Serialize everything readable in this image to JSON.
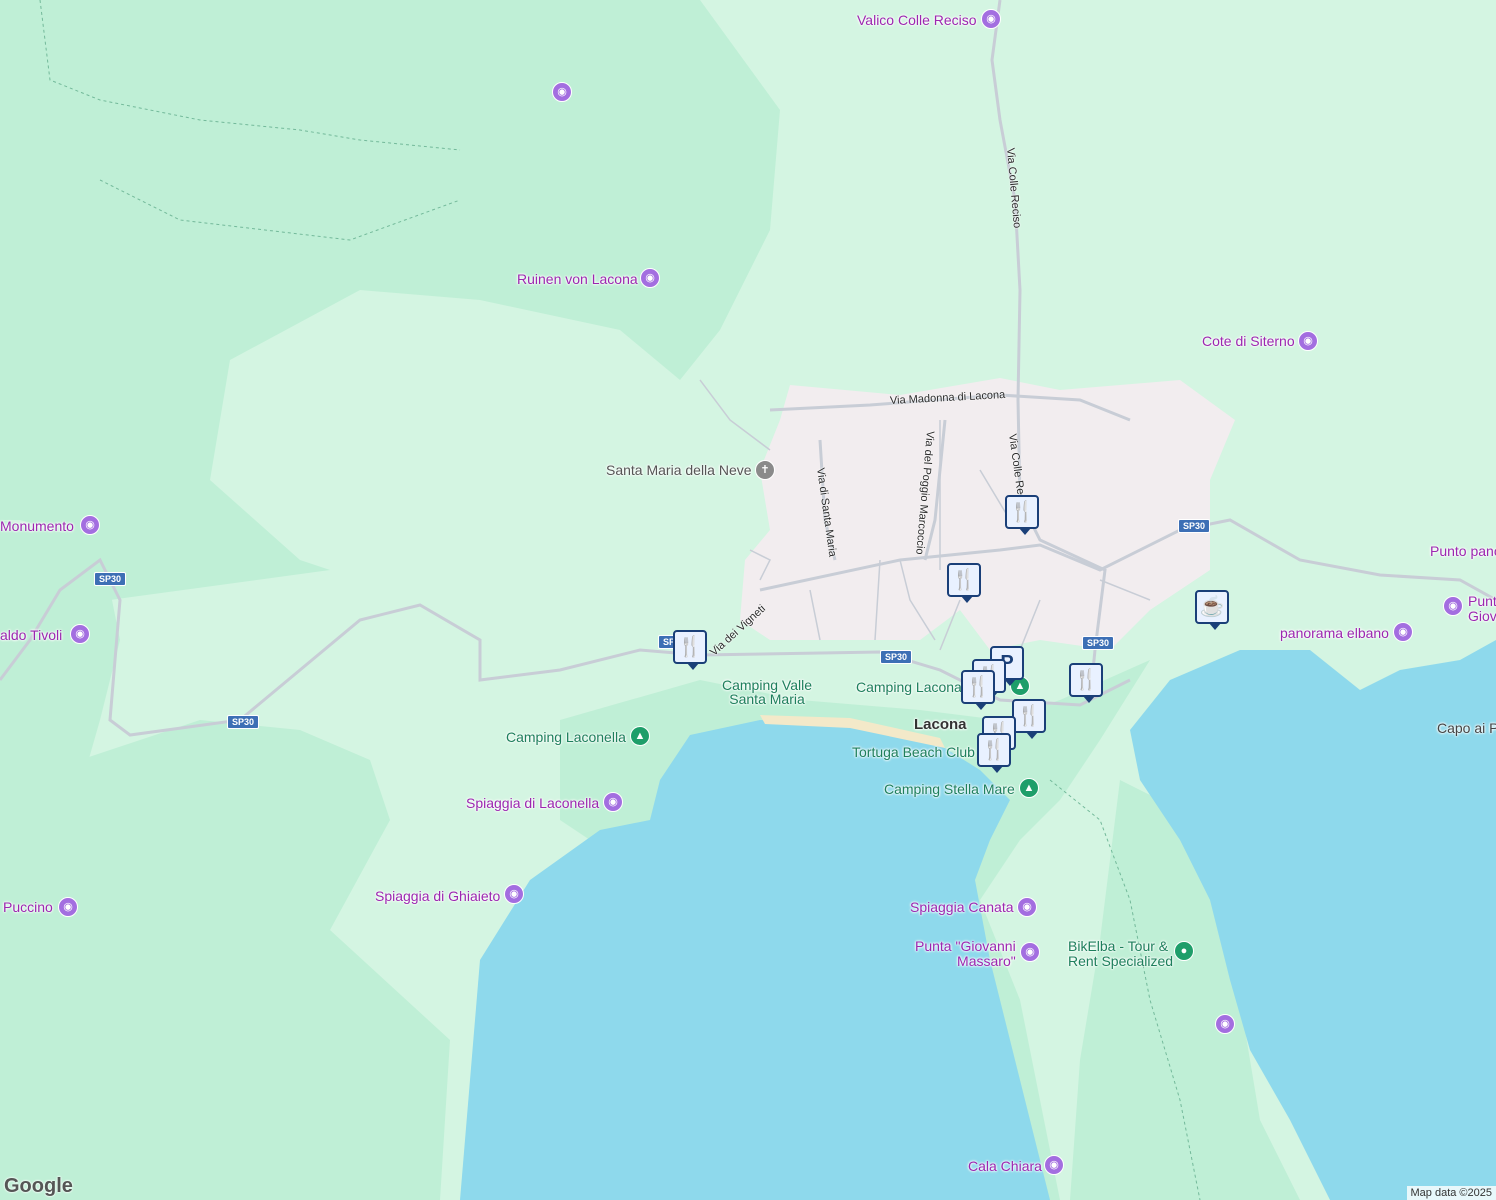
{
  "map": {
    "colors": {
      "land": "#d4f5e2",
      "forest": "#bfefd6",
      "water": "#8ed9ec",
      "urban": "#f2edef",
      "road": "#c8cdd6",
      "beach": "#f3e9c9"
    },
    "places": [
      {
        "id": "valico",
        "name": "Valico Colle Reciso",
        "kind": "poi"
      },
      {
        "id": "ruinen",
        "name": "Ruinen von Lacona",
        "kind": "poi"
      },
      {
        "id": "cote",
        "name": "Cote di Siterno",
        "kind": "poi"
      },
      {
        "id": "santa-maria",
        "name": "Santa Maria della Neve",
        "kind": "church"
      },
      {
        "id": "monumento",
        "name": "Monumento",
        "kind": "poi"
      },
      {
        "id": "tivoli",
        "name": "aldo Tivoli",
        "kind": "poi"
      },
      {
        "id": "punto-pano",
        "name": "Punto pano",
        "kind": "poi"
      },
      {
        "id": "punt-giov",
        "name": "Punt\nGiov",
        "kind": "poi"
      },
      {
        "id": "panorama",
        "name": "panorama elbano",
        "kind": "poi"
      },
      {
        "id": "capo",
        "name": "Capo ai P",
        "kind": "poi"
      },
      {
        "id": "camping-valle",
        "name": "Camping Valle\nSanta Maria",
        "kind": "camp"
      },
      {
        "id": "camping-lacona",
        "name": "Camping Lacona",
        "kind": "camp"
      },
      {
        "id": "lacona",
        "name": "Lacona",
        "kind": "town"
      },
      {
        "id": "camping-laconella",
        "name": "Camping Laconella",
        "kind": "camp"
      },
      {
        "id": "tortuga",
        "name": "Tortuga Beach Club",
        "kind": "camp"
      },
      {
        "id": "stella",
        "name": "Camping Stella Mare",
        "kind": "camp"
      },
      {
        "id": "spiaggia-laconella",
        "name": "Spiaggia di Laconella",
        "kind": "poi"
      },
      {
        "id": "spiaggia-ghiaieto",
        "name": "Spiaggia di Ghiaieto",
        "kind": "poi"
      },
      {
        "id": "puccino",
        "name": "Puccino",
        "kind": "poi"
      },
      {
        "id": "spiaggia-canata",
        "name": "Spiaggia Canata",
        "kind": "poi"
      },
      {
        "id": "punta-giovanni",
        "name": "Punta \"Giovanni\nMassaro\"",
        "kind": "poi"
      },
      {
        "id": "bikelba",
        "name": "BikElba - Tour &\nRent Specialized",
        "kind": "biz"
      },
      {
        "id": "cala-chiara",
        "name": "Cala Chiara",
        "kind": "poi"
      }
    ],
    "streets": {
      "colle_reciso_top": "Via Colle Reciso",
      "madonna": "Via Madonna di Lacona",
      "poggio": "Via del Poggio Marcoccio",
      "colle_reciso_low": "Via Colle Reciso",
      "santa_maria": "Via di Santa Maria",
      "vigneti": "Via dei Vigneti"
    },
    "shields": [
      "SP30",
      "SP30",
      "SP30",
      "SP30",
      "SP30",
      "SP30"
    ],
    "pins": {
      "restaurant": "restaurant-icon",
      "cafe": "cafe-icon",
      "parking": "P"
    },
    "attribution": {
      "logo": "Google",
      "data": "Map data ©2025"
    }
  }
}
